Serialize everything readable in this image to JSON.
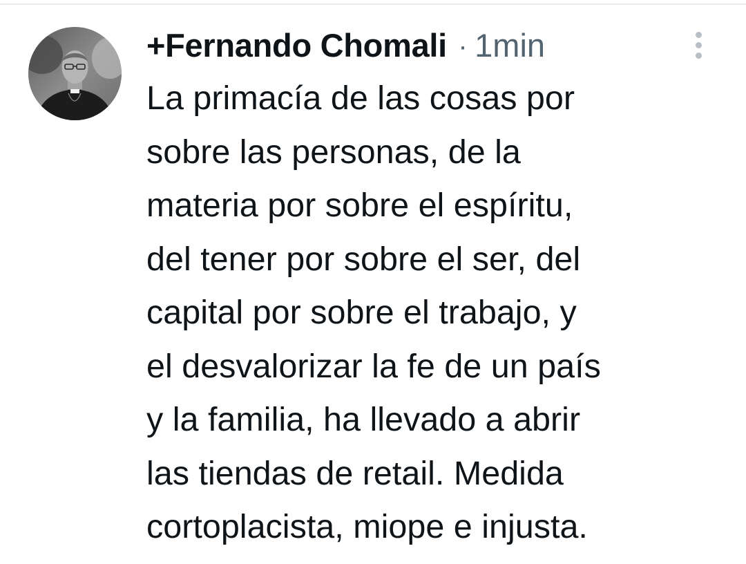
{
  "tweet": {
    "author_name": "+Fernando Chomali",
    "separator": "·",
    "timestamp": "1min",
    "more_icon": "more-vertical-icon",
    "avatar_icon": "profile-photo",
    "text_lines": [
      "La primacía de las cosas por",
      "sobre las personas, de la",
      "materia por sobre el espíritu,",
      "del tener por sobre el ser, del",
      "capital por sobre el trabajo, y",
      "el desvalorizar la fe de un país",
      "y la familia, ha llevado a abrir",
      "las tiendas de retail. Medida",
      "cortoplacista, miope e injusta."
    ]
  },
  "colors": {
    "text_primary": "#0f1419",
    "text_secondary": "#536471",
    "icon_muted": "#b8bfc6",
    "background": "#ffffff"
  }
}
